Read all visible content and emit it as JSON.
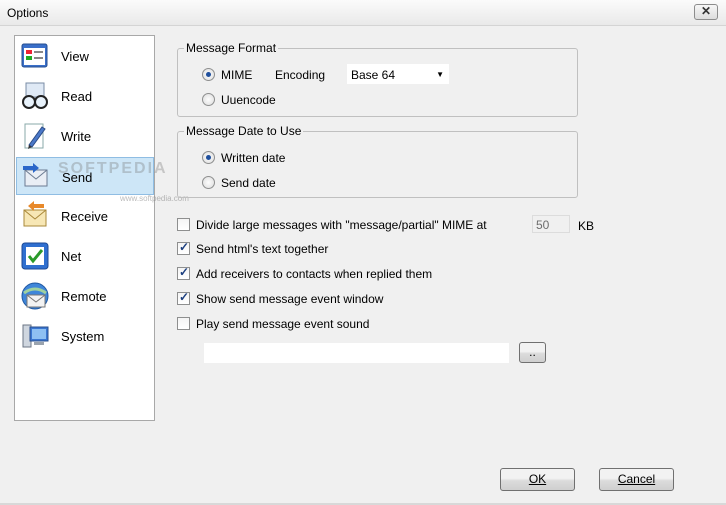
{
  "window": {
    "title": "Options",
    "close_glyph": "✕"
  },
  "sidebar": {
    "items": [
      {
        "label": "View",
        "icon": "view-icon"
      },
      {
        "label": "Read",
        "icon": "read-icon"
      },
      {
        "label": "Write",
        "icon": "write-icon"
      },
      {
        "label": "Send",
        "icon": "send-icon",
        "selected": true
      },
      {
        "label": "Receive",
        "icon": "receive-icon"
      },
      {
        "label": "Net",
        "icon": "net-icon"
      },
      {
        "label": "Remote",
        "icon": "remote-icon"
      },
      {
        "label": "System",
        "icon": "system-icon"
      }
    ]
  },
  "watermark": {
    "text": "SOFTPEDIA",
    "url": "www.softpedia.com"
  },
  "message_format": {
    "legend": "Message Format",
    "mime_label": "MIME",
    "encoding_label": "Encoding",
    "encoding_value": "Base 64",
    "uuencode_label": "Uuencode",
    "selected": "MIME"
  },
  "message_date": {
    "legend": "Message Date to Use",
    "written_label": "Written date",
    "send_label": "Send date",
    "selected": "Written date"
  },
  "options": {
    "divide_label": "Divide large messages with \"message/partial\" MIME at",
    "divide_checked": false,
    "divide_size": "50",
    "divide_unit": "KB",
    "html_label": "Send html's text together",
    "html_checked": true,
    "receivers_label": "Add receivers to contacts when replied them",
    "receivers_checked": true,
    "event_window_label": "Show send message event window",
    "event_window_checked": true,
    "sound_label": "Play send message event sound",
    "sound_checked": false,
    "sound_path": "",
    "browse_label": ".."
  },
  "buttons": {
    "ok_label": "OK",
    "cancel_label": "Cancel"
  },
  "colors": {
    "selected_bg": "#cde6f7",
    "selected_border": "#8fbde3"
  }
}
